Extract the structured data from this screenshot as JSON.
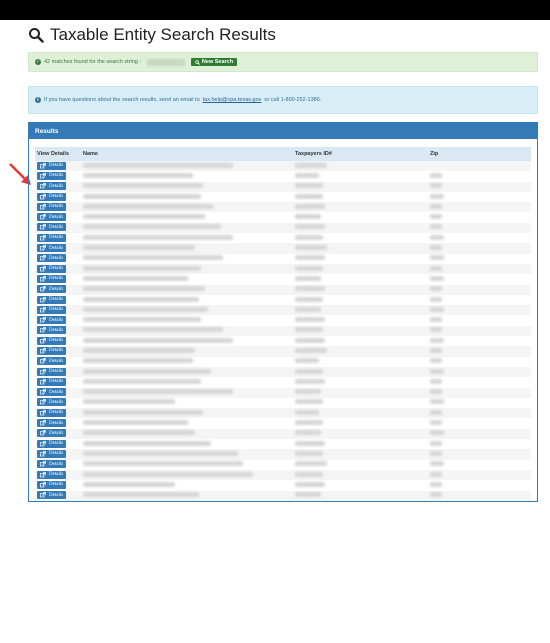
{
  "page": {
    "title": "Taxable Entity Search Results"
  },
  "success_alert": {
    "text": "42 matches found for the search string :",
    "button": "New Search",
    "colors": {
      "bg": "#dff0d8",
      "text": "#3c763d",
      "button": "#2e7d32"
    }
  },
  "info_alert": {
    "text_before": "If you have questions about the search results, send an email to",
    "email": "tax.help@cpa.texas.gov",
    "text_after": "or call 1-800-252-1386."
  },
  "panel": {
    "heading": "Results",
    "columns": [
      "View Details",
      "Name",
      "Taxpayers ID#",
      "Zip"
    ],
    "details_label": "Details",
    "row_count": 33,
    "accent": "#337ab7"
  },
  "icons": {
    "title_icon": "search-icon",
    "details_icon": "external-link-icon",
    "arrow": "red-arrow-annotation"
  }
}
